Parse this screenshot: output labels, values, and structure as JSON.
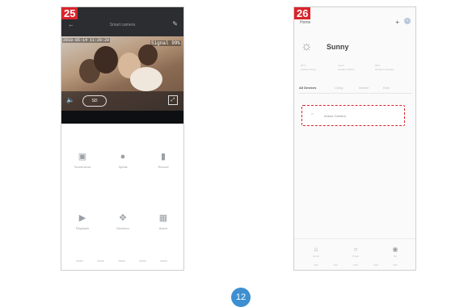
{
  "step1": {
    "badge": "25",
    "app_title": "Smart camera",
    "timestamp": "2018-05-14 11:20:20",
    "signal": "Signal 99%",
    "sd_label": "SD",
    "grid": [
      {
        "icon": "camera-icon",
        "label": "Screenshot"
      },
      {
        "icon": "mic-icon",
        "label": "Speak"
      },
      {
        "icon": "video-record-icon",
        "label": "Record"
      },
      {
        "icon": "playback-icon",
        "label": "Playback"
      },
      {
        "icon": "direction-icon",
        "label": "Direction"
      },
      {
        "icon": "alarm-icon",
        "label": "Alarm"
      }
    ]
  },
  "step2": {
    "badge": "26",
    "home_label": "Home",
    "weather": "Sunny",
    "stats": [
      {
        "value": "25°C",
        "label": "Outdoor Temp."
      },
      {
        "value": "Good",
        "label": "Outdoor PM2.5"
      },
      {
        "value": "60%",
        "label": "Outdoor Humidity"
      }
    ],
    "tabs": [
      "All Devices",
      "Living",
      "Master",
      "Kids"
    ],
    "device_name": "Indoor Camera",
    "nav": [
      {
        "icon": "home-icon",
        "label": "Home"
      },
      {
        "icon": "smart-icon",
        "label": "Smart"
      },
      {
        "icon": "profile-icon",
        "label": "Me"
      }
    ]
  },
  "page_number": "12"
}
